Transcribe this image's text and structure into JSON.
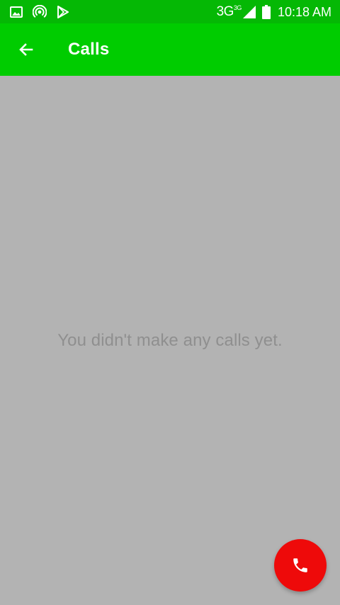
{
  "status_bar": {
    "icons_left": [
      "image-icon",
      "hotspot-icon",
      "play-store-icon"
    ],
    "network": "3G",
    "network_superscript": "3G",
    "signal_icon": "signal-icon",
    "battery_icon": "battery-icon",
    "time": "10:18 AM"
  },
  "app_bar": {
    "back_icon": "arrow-left-icon",
    "title": "Calls"
  },
  "content": {
    "empty_message": "You didn't make any calls yet."
  },
  "fab": {
    "icon": "phone-icon"
  },
  "colors": {
    "status_bar": "#05b805",
    "app_bar": "#00cc00",
    "content_background": "#b3b3b3",
    "empty_text": "#8f8f8f",
    "fab": "#ee0a0a"
  }
}
